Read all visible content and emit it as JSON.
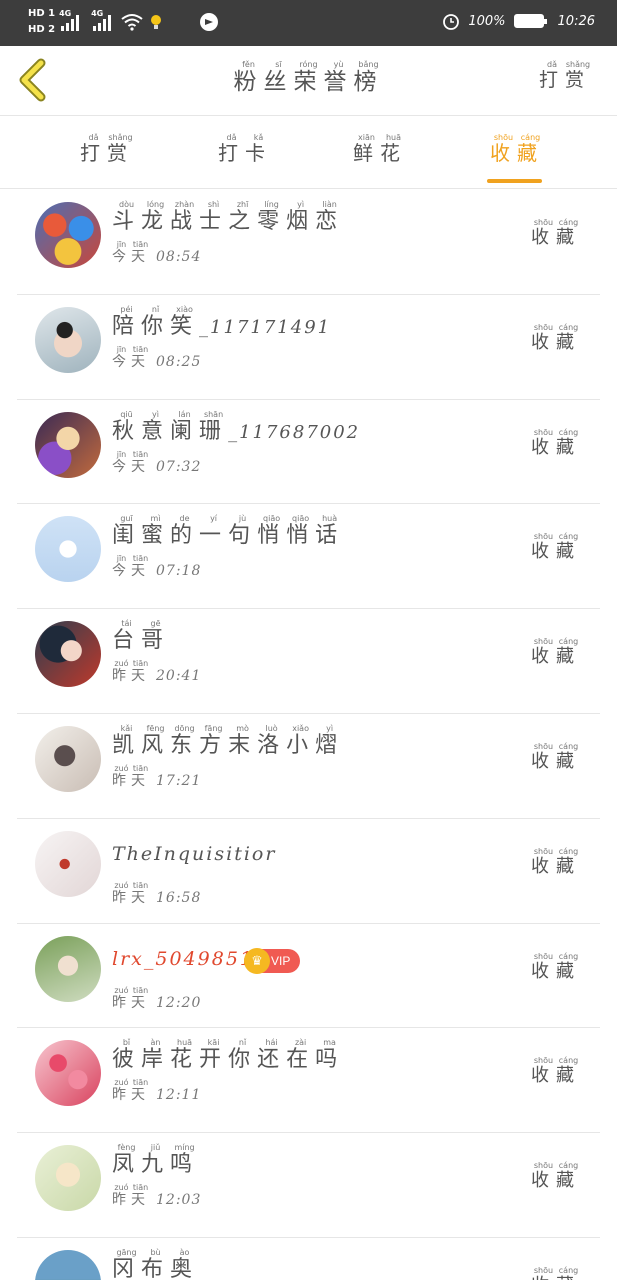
{
  "status_bar": {
    "hd1": "HD 1",
    "hd2": "HD 2",
    "net1": "4G",
    "net2": "4G",
    "battery": "100%",
    "time": "10:26"
  },
  "header": {
    "title": [
      {
        "c": "粉",
        "p": "fěn"
      },
      {
        "c": "丝",
        "p": "sī"
      },
      {
        "c": "荣",
        "p": "róng"
      },
      {
        "c": "誉",
        "p": "yù"
      },
      {
        "c": "榜",
        "p": "bǎng"
      }
    ],
    "action": [
      {
        "c": "打",
        "p": "dǎ"
      },
      {
        "c": "赏",
        "p": "shǎng"
      }
    ]
  },
  "tabs": [
    {
      "chars": [
        {
          "c": "打",
          "p": "dǎ"
        },
        {
          "c": "赏",
          "p": "shǎng"
        }
      ],
      "active": false
    },
    {
      "chars": [
        {
          "c": "打",
          "p": "dǎ"
        },
        {
          "c": "卡",
          "p": "kǎ"
        }
      ],
      "active": false
    },
    {
      "chars": [
        {
          "c": "鲜",
          "p": "xiān"
        },
        {
          "c": "花",
          "p": "huā"
        }
      ],
      "active": false
    },
    {
      "chars": [
        {
          "c": "收",
          "p": "shōu"
        },
        {
          "c": "藏",
          "p": "cáng"
        }
      ],
      "active": true
    }
  ],
  "row_action": [
    {
      "c": "收",
      "p": "shōu"
    },
    {
      "c": "藏",
      "p": "cáng"
    }
  ],
  "day_today": [
    {
      "c": "今",
      "p": "jīn"
    },
    {
      "c": "天",
      "p": "tiān"
    }
  ],
  "day_yesterday": [
    {
      "c": "昨",
      "p": "zuó"
    },
    {
      "c": "天",
      "p": "tiān"
    }
  ],
  "rows": [
    {
      "name": [
        {
          "c": "斗",
          "p": "dòu"
        },
        {
          "c": "龙",
          "p": "lóng"
        },
        {
          "c": "战",
          "p": "zhàn"
        },
        {
          "c": "士",
          "p": "shì"
        },
        {
          "c": "之",
          "p": "zhī"
        },
        {
          "c": "零",
          "p": "líng"
        },
        {
          "c": "烟",
          "p": "yì"
        },
        {
          "c": "恋",
          "p": "liàn"
        }
      ],
      "suffix": "",
      "day": "today",
      "clock": "08:54",
      "avatar": "game-characters"
    },
    {
      "name": [
        {
          "c": "陪",
          "p": "péi"
        },
        {
          "c": "你",
          "p": "nǐ"
        },
        {
          "c": "笑",
          "p": "xiào"
        }
      ],
      "suffix": "_117171491",
      "day": "today",
      "clock": "08:25",
      "avatar": "person-with-glasses"
    },
    {
      "name": [
        {
          "c": "秋",
          "p": "qiū"
        },
        {
          "c": "意",
          "p": "yì"
        },
        {
          "c": "阑",
          "p": "lán"
        },
        {
          "c": "珊",
          "p": "shān"
        }
      ],
      "suffix": "_117687002",
      "day": "today",
      "clock": "07:32",
      "avatar": "anime-girl"
    },
    {
      "name": [
        {
          "c": "闺",
          "p": "guī"
        },
        {
          "c": "蜜",
          "p": "mì"
        },
        {
          "c": "的",
          "p": "de"
        },
        {
          "c": "一",
          "p": "yí"
        },
        {
          "c": "句",
          "p": "jù"
        },
        {
          "c": "悄",
          "p": "qiāo"
        },
        {
          "c": "悄",
          "p": "qiāo"
        },
        {
          "c": "话",
          "p": "huà"
        }
      ],
      "suffix": "",
      "day": "today",
      "clock": "07:18",
      "avatar": "default-star"
    },
    {
      "name": [
        {
          "c": "台",
          "p": "tái"
        },
        {
          "c": "哥",
          "p": "gē"
        }
      ],
      "suffix": "",
      "day": "yesterday",
      "clock": "20:41",
      "avatar": "anime-boy"
    },
    {
      "name": [
        {
          "c": "凯",
          "p": "kǎi"
        },
        {
          "c": "风",
          "p": "fēng"
        },
        {
          "c": "东",
          "p": "dōng"
        },
        {
          "c": "方",
          "p": "fāng"
        },
        {
          "c": "末",
          "p": "mò"
        },
        {
          "c": "洛",
          "p": "luò"
        },
        {
          "c": "小",
          "p": "xiǎo"
        },
        {
          "c": "熠",
          "p": "yì"
        }
      ],
      "suffix": "",
      "day": "yesterday",
      "clock": "17:21",
      "avatar": "ink-painting"
    },
    {
      "name": [],
      "suffix": "TheInquisitior",
      "day": "yesterday",
      "clock": "16:58",
      "avatar": "white-red-eye"
    },
    {
      "name": [],
      "suffix": "lrx_504985112",
      "red": true,
      "vip": "VIP",
      "day": "yesterday",
      "clock": "12:20",
      "avatar": "child-photo"
    },
    {
      "name": [
        {
          "c": "彼",
          "p": "bǐ"
        },
        {
          "c": "岸",
          "p": "àn"
        },
        {
          "c": "花",
          "p": "huā"
        },
        {
          "c": "开",
          "p": "kāi"
        },
        {
          "c": "你",
          "p": "nǐ"
        },
        {
          "c": "还",
          "p": "hái"
        },
        {
          "c": "在",
          "p": "zài"
        },
        {
          "c": "吗",
          "p": "ma"
        }
      ],
      "suffix": "",
      "day": "yesterday",
      "clock": "12:11",
      "avatar": "pink-flowers"
    },
    {
      "name": [
        {
          "c": "凤",
          "p": "fèng"
        },
        {
          "c": "九",
          "p": "jiǔ"
        },
        {
          "c": "鸣",
          "p": "míng"
        }
      ],
      "suffix": "",
      "day": "yesterday",
      "clock": "12:03",
      "avatar": "pastel-illustration"
    },
    {
      "name": [
        {
          "c": "冈",
          "p": "gāng"
        },
        {
          "c": "布",
          "p": "bù"
        },
        {
          "c": "奥",
          "p": "ào"
        }
      ],
      "suffix": "",
      "day": "",
      "clock": "",
      "avatar": "landscape"
    }
  ],
  "colors": {
    "accent": "#f0a21f",
    "vip": "#f05a52",
    "status_bar": "#3d3d3d"
  }
}
